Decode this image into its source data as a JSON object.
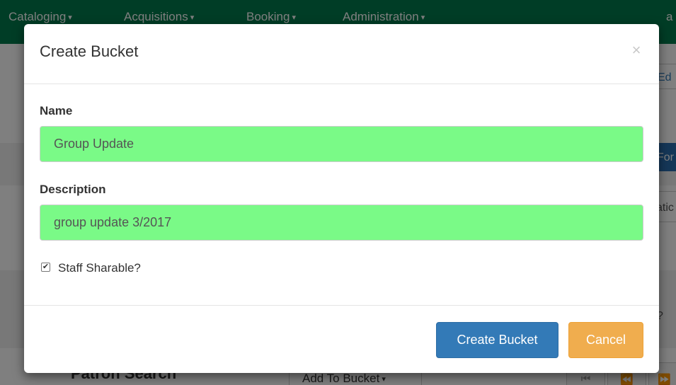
{
  "navbar": {
    "items": [
      {
        "label": "Cataloging",
        "caret": "▾"
      },
      {
        "label": "Acquisitions",
        "caret": "▾"
      },
      {
        "label": "Booking",
        "caret": "▾"
      },
      {
        "label": "Administration",
        "caret": "▾"
      }
    ],
    "right_fragment": "a"
  },
  "background": {
    "right_fragments": [
      "Ed",
      "For",
      "atic",
      "?"
    ],
    "bottom_title": "Patron Search",
    "bottom_button": "Add To Bucket",
    "bottom_button_caret": "▾",
    "pager_icons": [
      "first-page-icon",
      "previous-page-icon",
      "next-page-icon"
    ],
    "pager_glyphs": [
      "⏮",
      "⏪",
      "⏩"
    ]
  },
  "modal": {
    "title": "Create Bucket",
    "close_glyph": "×",
    "name_label": "Name",
    "name_value": "Group Update",
    "description_label": "Description",
    "description_value": "group update 3/2017",
    "staff_sharable_label": "Staff Sharable?",
    "staff_sharable_checked": true,
    "check_glyph": "✔",
    "create_button": "Create Bucket",
    "cancel_button": "Cancel"
  },
  "colors": {
    "navbar": "#007a4d",
    "primary": "#337ab7",
    "warning": "#f0ad4e",
    "input_highlight": "#7afa87"
  }
}
